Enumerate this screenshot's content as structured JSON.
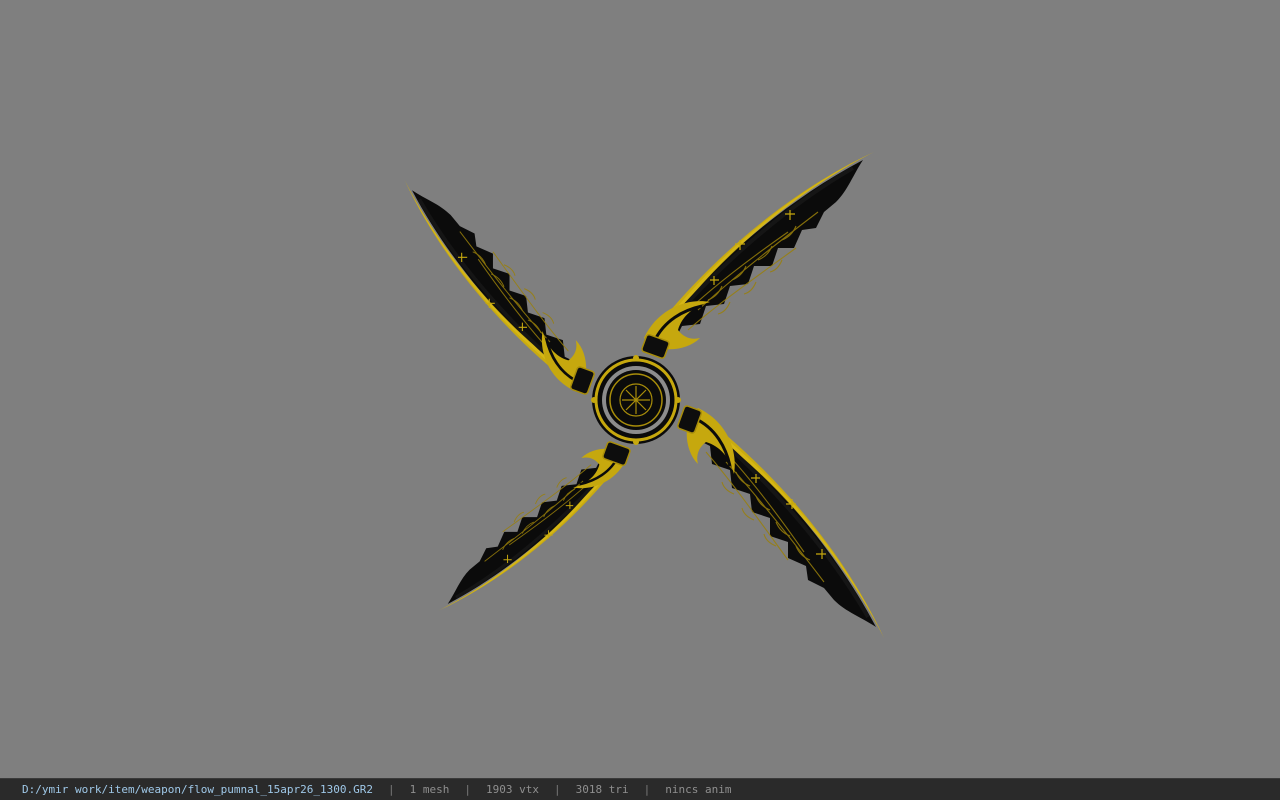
{
  "viewport": {
    "background_color": "#7f7f7f",
    "model_colors": {
      "gold": "#c6a80e",
      "gold_dark": "#8a7206",
      "black": "#0a0a0a"
    },
    "model_icon": "winged-shuriken-model"
  },
  "status_bar": {
    "file_path": "D:/ymir work/item/weapon/flow_pumnal_15apr26_1300.GR2",
    "separator": "|",
    "mesh_count": "1 mesh",
    "vertex_count": "1903 vtx",
    "triangle_count": "3018 tri",
    "animation": "nincs anim"
  }
}
